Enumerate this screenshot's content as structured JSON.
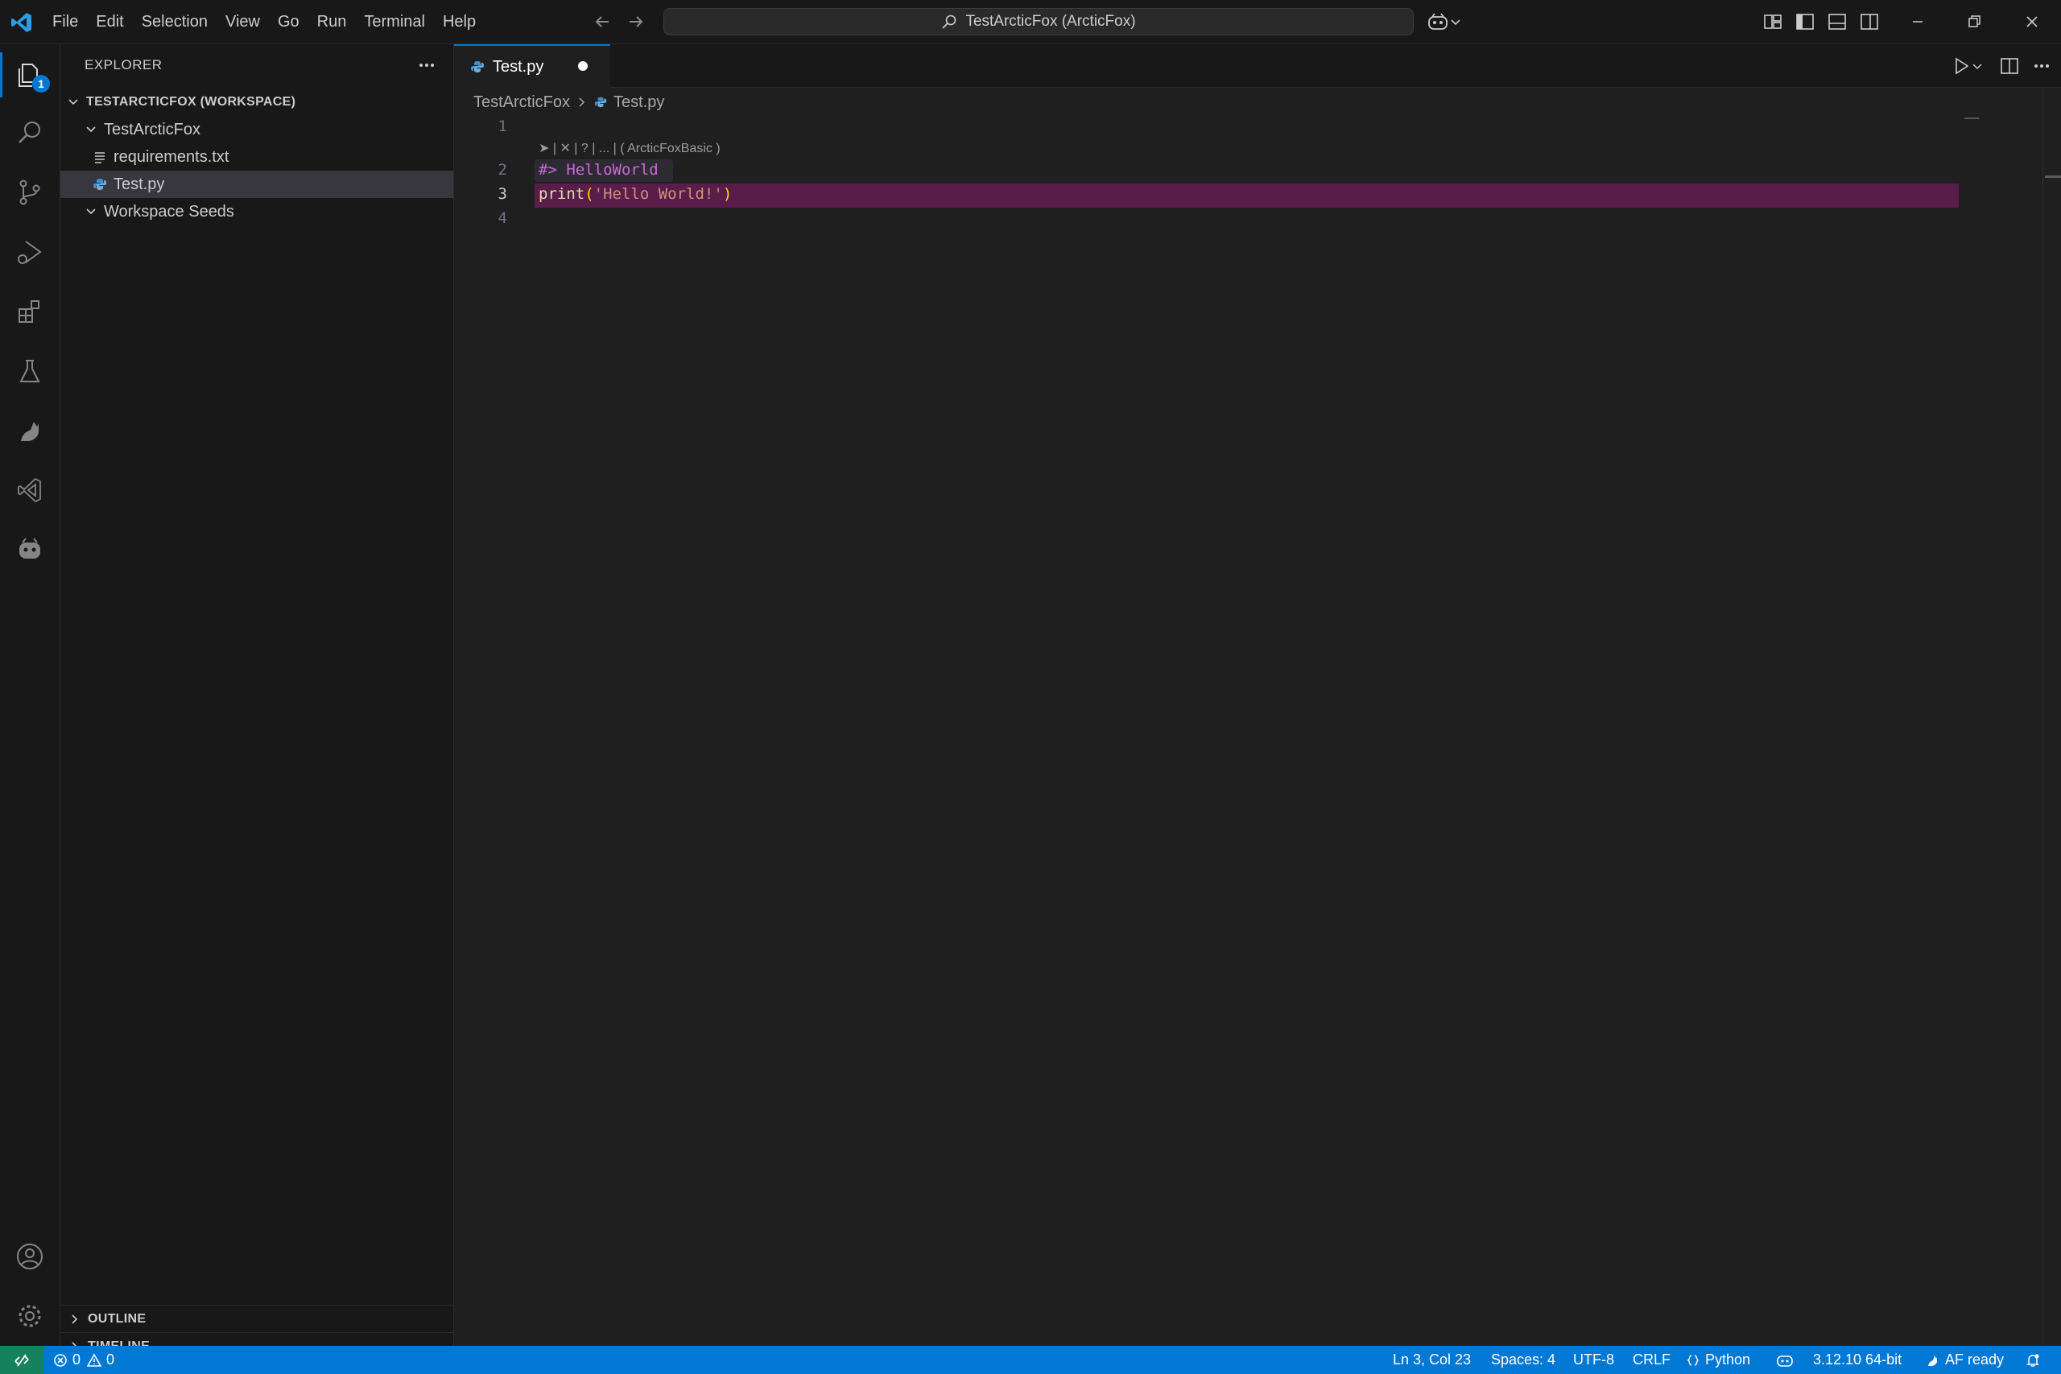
{
  "window": {
    "command_center": "TestArcticFox (ArcticFox)"
  },
  "menu": [
    "File",
    "Edit",
    "Selection",
    "View",
    "Go",
    "Run",
    "Terminal",
    "Help"
  ],
  "activity_bar": {
    "explorer_badge": "1"
  },
  "sidebar": {
    "title": "EXPLORER",
    "workspace": "TESTARCTICFOX (WORKSPACE)",
    "folder": "TestArcticFox",
    "files": [
      "requirements.txt",
      "Test.py"
    ],
    "selected_file": "Test.py",
    "second_folder": "Workspace Seeds",
    "panels": [
      "OUTLINE",
      "TIMELINE"
    ]
  },
  "editor": {
    "tab": "Test.py",
    "tab_dirty": true,
    "breadcrumb": [
      "TestArcticFox",
      "Test.py"
    ],
    "codelens": "➤ | ✕ | ? | ... | ( ArcticFoxBasic )",
    "lines": [
      {
        "num": "1",
        "text": ""
      },
      {
        "num": "2",
        "text": "#> HelloWorld"
      },
      {
        "num": "3",
        "text": "print('Hello World!')"
      },
      {
        "num": "4",
        "text": ""
      }
    ],
    "code_line3": {
      "fn": "print",
      "open": "(",
      "str": "'Hello World!'",
      "close": ")"
    },
    "active_line": "3"
  },
  "status_bar": {
    "errors": "0",
    "warnings": "0",
    "cursor": "Ln 3, Col 23",
    "indent": "Spaces: 4",
    "encoding": "UTF-8",
    "eol": "CRLF",
    "language": "Python",
    "interpreter": "3.12.10 64-bit",
    "af_status": "AF ready"
  },
  "colors": {
    "accent": "#0078d4",
    "status_bar": "#0078d4",
    "remote": "#16825d",
    "active_line": "#5a1d4a",
    "comment": "#c46bd6"
  }
}
